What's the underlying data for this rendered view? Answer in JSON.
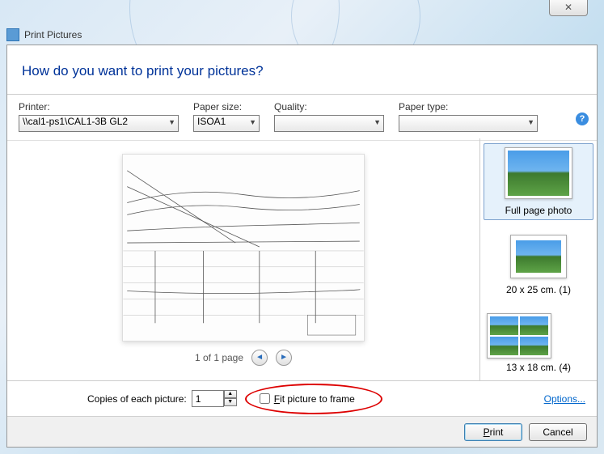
{
  "window": {
    "close_glyph": "✕",
    "title": "Print Pictures"
  },
  "header": {
    "question": "How do you want to print your pictures?"
  },
  "controls": {
    "printer": {
      "label": "Printer:",
      "value": "\\\\cal1-ps1\\CAL1-3B GL2"
    },
    "paper_size": {
      "label": "Paper size:",
      "value": "ISOA1"
    },
    "quality": {
      "label": "Quality:",
      "value": ""
    },
    "paper_type": {
      "label": "Paper type:",
      "value": ""
    },
    "help_glyph": "?"
  },
  "pager": {
    "text": "1 of 1 page",
    "prev_glyph": "◄",
    "next_glyph": "►"
  },
  "layouts": [
    {
      "label": "Full page photo"
    },
    {
      "label": "20 x 25 cm. (1)"
    },
    {
      "label": "13 x 18 cm. (4)"
    }
  ],
  "bottom": {
    "copies_label": "Copies of each picture:",
    "copies_value": "1",
    "fit_label": "Fit picture to frame",
    "fit_checked": false,
    "options_link": "Options..."
  },
  "actions": {
    "print": "Print",
    "cancel": "Cancel"
  }
}
